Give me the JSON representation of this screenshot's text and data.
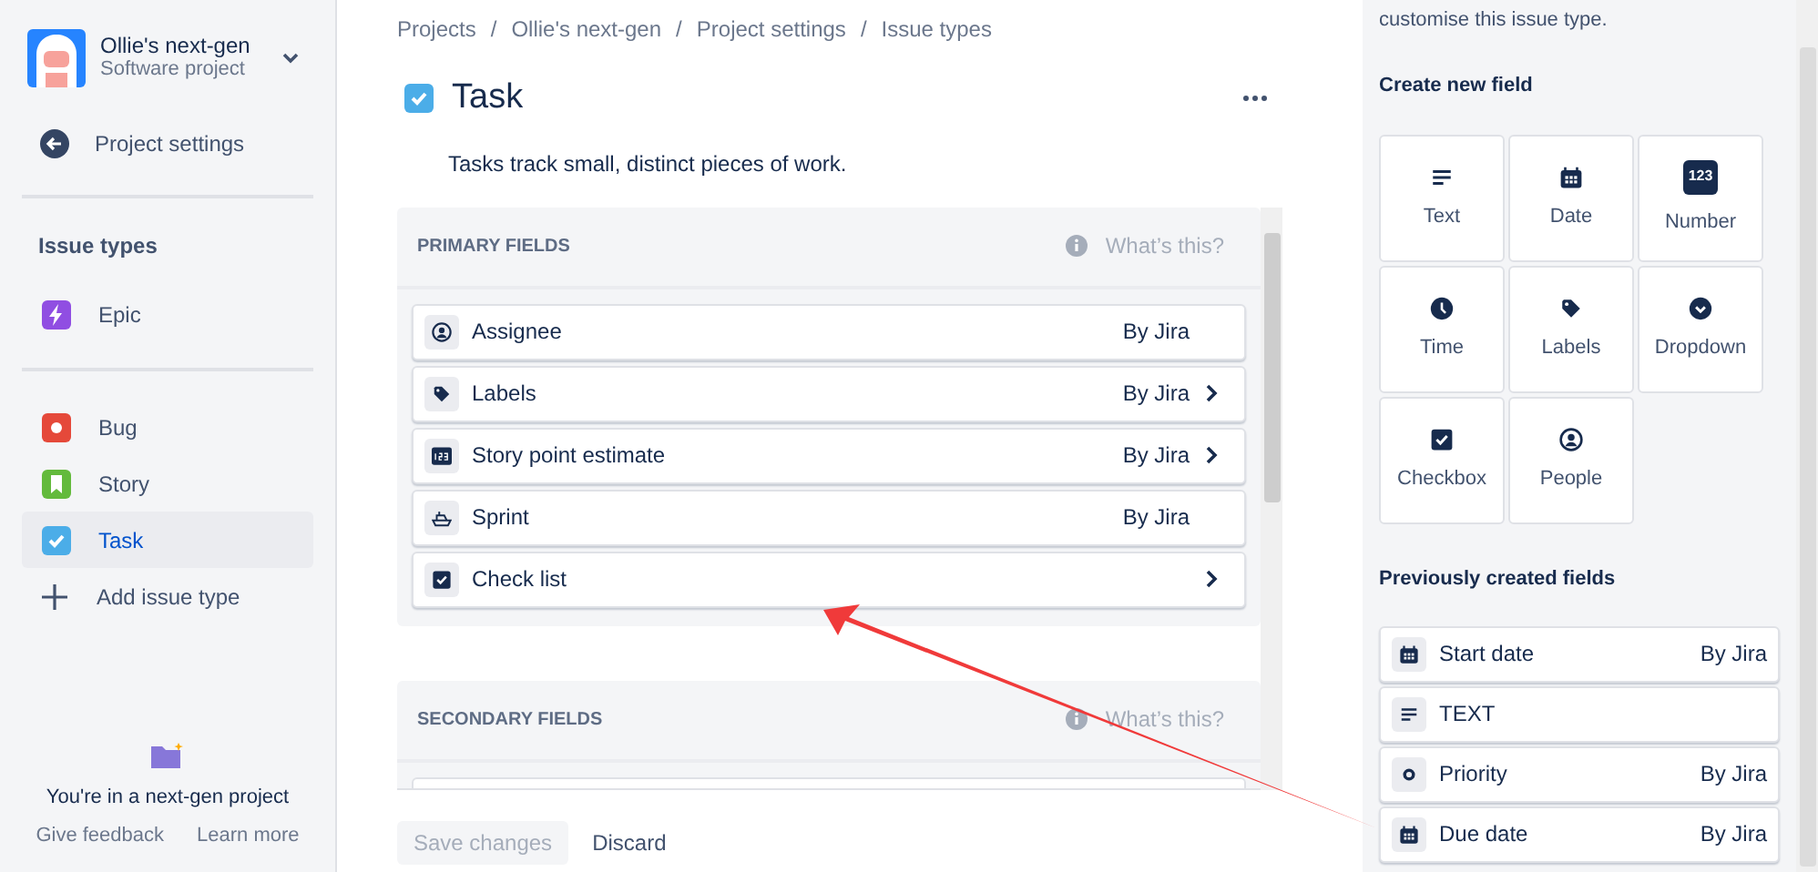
{
  "project": {
    "name": "Ollie's next-gen",
    "type": "Software project"
  },
  "sidebar": {
    "back": "Project settings",
    "section_title": "Issue types",
    "groups": [
      [
        {
          "label": "Epic",
          "kind": "epic",
          "color": "#904ee2",
          "selected": false
        }
      ],
      [
        {
          "label": "Bug",
          "kind": "bug",
          "color": "#e5493a",
          "selected": false
        },
        {
          "label": "Story",
          "kind": "story",
          "color": "#63ba3c",
          "selected": false
        },
        {
          "label": "Task",
          "kind": "task",
          "color": "#4bade8",
          "selected": true
        }
      ]
    ],
    "add": "Add issue type",
    "footer": {
      "message": "You're in a next-gen project",
      "links": [
        "Give feedback",
        "Learn more"
      ]
    }
  },
  "breadcrumbs": [
    "Projects",
    "Ollie's next-gen",
    "Project settings",
    "Issue types"
  ],
  "breadcrumb_separators": [
    "/",
    "/",
    "/"
  ],
  "title": "Task",
  "description": "Tasks track small, distinct pieces of work.",
  "sections": [
    {
      "title": "PRIMARY FIELDS",
      "help": "What’s this?",
      "fields": [
        {
          "name": "Assignee",
          "kind": "person",
          "source": "By Jira",
          "expandable": false
        },
        {
          "name": "Labels",
          "kind": "label",
          "source": "By Jira",
          "expandable": true
        },
        {
          "name": "Story point estimate",
          "kind": "number",
          "source": "By Jira",
          "expandable": true
        },
        {
          "name": "Sprint",
          "kind": "sprint",
          "source": "By Jira",
          "expandable": false
        },
        {
          "name": "Check list",
          "kind": "checkbox",
          "expandable": true
        }
      ]
    },
    {
      "title": "SECONDARY FIELDS",
      "help": "What’s this?"
    }
  ],
  "actions": {
    "save": {
      "label": "Save changes",
      "disabled": true
    },
    "discard": "Discard"
  },
  "panel": {
    "hint": "customise this issue type.",
    "create_title": "Create new field",
    "create": [
      {
        "label": "Text",
        "kind": "text"
      },
      {
        "label": "Date",
        "kind": "date"
      },
      {
        "label": "Number",
        "kind": "number",
        "icon_text": "123"
      },
      {
        "label": "Time",
        "kind": "time"
      },
      {
        "label": "Labels",
        "kind": "label"
      },
      {
        "label": "Dropdown",
        "kind": "dropdown"
      },
      {
        "label": "Checkbox",
        "kind": "checkbox"
      },
      {
        "label": "People",
        "kind": "person"
      }
    ],
    "previous_title": "Previously created fields",
    "previous": [
      {
        "name": "Start date",
        "kind": "date",
        "source": "By Jira"
      },
      {
        "name": "TEXT",
        "kind": "text"
      },
      {
        "name": "Priority",
        "kind": "priority",
        "source": "By Jira"
      },
      {
        "name": "Due date",
        "kind": "date",
        "source": "By Jira"
      }
    ]
  }
}
